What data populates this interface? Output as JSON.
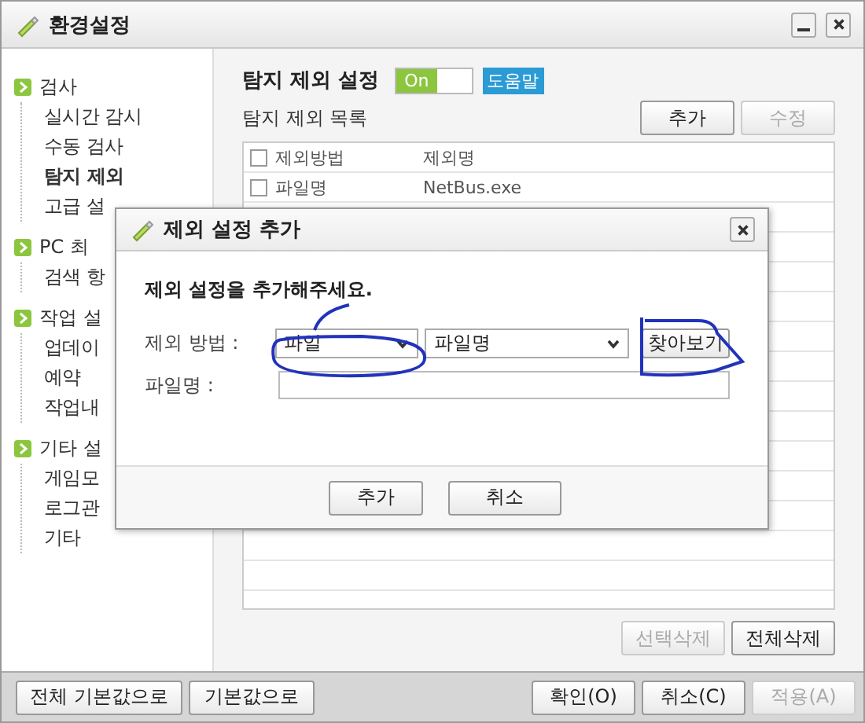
{
  "window": {
    "title": "환경설정"
  },
  "sidebar": {
    "groups": [
      {
        "label": "검사",
        "items": [
          {
            "label": "실시간 감시",
            "selected": false
          },
          {
            "label": "수동 검사",
            "selected": false
          },
          {
            "label": "탐지 제외",
            "selected": true
          },
          {
            "label": "고급 설",
            "selected": false
          }
        ]
      },
      {
        "label": "PC 최",
        "items": [
          {
            "label": "검색 항",
            "selected": false
          }
        ]
      },
      {
        "label": "작업 설",
        "items": [
          {
            "label": "업데이",
            "selected": false
          },
          {
            "label": "예약",
            "selected": false
          },
          {
            "label": "작업내",
            "selected": false
          }
        ]
      },
      {
        "label": "기타 설",
        "items": [
          {
            "label": "게임모",
            "selected": false
          },
          {
            "label": "로그관",
            "selected": false
          },
          {
            "label": "기타",
            "selected": false
          }
        ]
      }
    ]
  },
  "content": {
    "heading": "탐지 제외 설정",
    "toggle": {
      "label": "On",
      "on": true
    },
    "help": "도움말",
    "list_title": "탐지 제외 목록",
    "list_buttons": [
      {
        "label": "추가",
        "disabled": false
      },
      {
        "label": "수정",
        "disabled": true
      }
    ],
    "table": {
      "columns": [
        "제외방법",
        "제외명"
      ],
      "all_checked": false,
      "rows": [
        {
          "method": "파일명",
          "name": "NetBus.exe",
          "checked": false
        }
      ]
    },
    "bottom_buttons": [
      {
        "label": "선택삭제",
        "disabled": true
      },
      {
        "label": "전체삭제",
        "disabled": false
      }
    ]
  },
  "footer": {
    "left_buttons": [
      {
        "label": "전체 기본값으로",
        "disabled": false
      },
      {
        "label": "기본값으로",
        "disabled": false
      }
    ],
    "right_buttons": [
      {
        "label": "확인(O)",
        "disabled": false
      },
      {
        "label": "취소(C)",
        "disabled": false
      },
      {
        "label": "적용(A)",
        "disabled": true
      }
    ]
  },
  "dialog": {
    "title": "제외 설정 추가",
    "prompt": "제외 설정을 추가해주세요.",
    "method_label": "제외 방법 :",
    "method_value": "파일",
    "type_value": "파일명",
    "browse": "찾아보기",
    "name_label": "파일명 :",
    "buttons": [
      "추가",
      "취소"
    ]
  }
}
